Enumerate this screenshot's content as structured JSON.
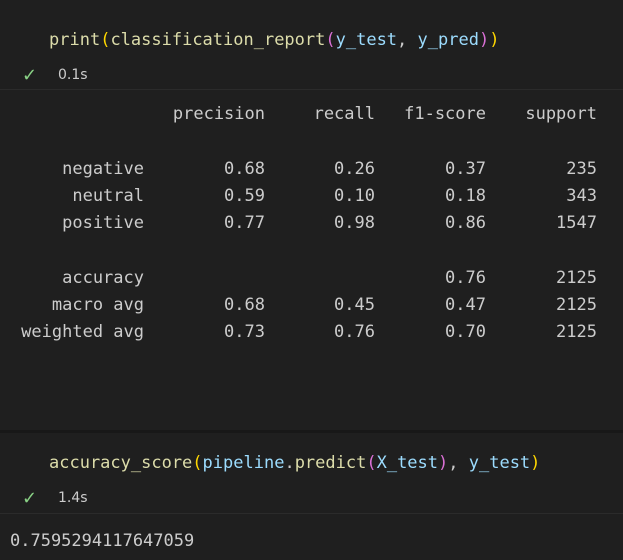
{
  "cells": [
    {
      "code": {
        "fn": "print",
        "open1": "(",
        "fn2": "classification_report",
        "open2": "(",
        "arg1": "y_test",
        "sep": ", ",
        "arg2": "y_pred",
        "close2": ")",
        "close1": ")"
      },
      "status": {
        "time": "0.1s"
      }
    },
    {
      "code": {
        "fn": "accuracy_score",
        "open1": "(",
        "obj": "pipeline",
        "dot": ".",
        "method": "predict",
        "open2": "(",
        "arg1": "X_test",
        "close2": ")",
        "sep": ", ",
        "arg2": "y_test",
        "close1": ")"
      },
      "status": {
        "time": "1.4s"
      }
    }
  ],
  "report": {
    "headers": [
      "precision",
      "recall",
      "f1-score",
      "support"
    ],
    "rows": [
      {
        "label": "negative",
        "precision": "0.68",
        "recall": "0.26",
        "f1": "0.37",
        "support": "235"
      },
      {
        "label": "neutral",
        "precision": "0.59",
        "recall": "0.10",
        "f1": "0.18",
        "support": "343"
      },
      {
        "label": "positive",
        "precision": "0.77",
        "recall": "0.98",
        "f1": "0.86",
        "support": "1547"
      },
      {
        "label": "accuracy",
        "precision": "",
        "recall": "",
        "f1": "0.76",
        "support": "2125"
      },
      {
        "label": "macro avg",
        "precision": "0.68",
        "recall": "0.45",
        "f1": "0.47",
        "support": "2125"
      },
      {
        "label": "weighted avg",
        "precision": "0.73",
        "recall": "0.76",
        "f1": "0.70",
        "support": "2125"
      }
    ]
  },
  "result": "0.7595294117647059"
}
